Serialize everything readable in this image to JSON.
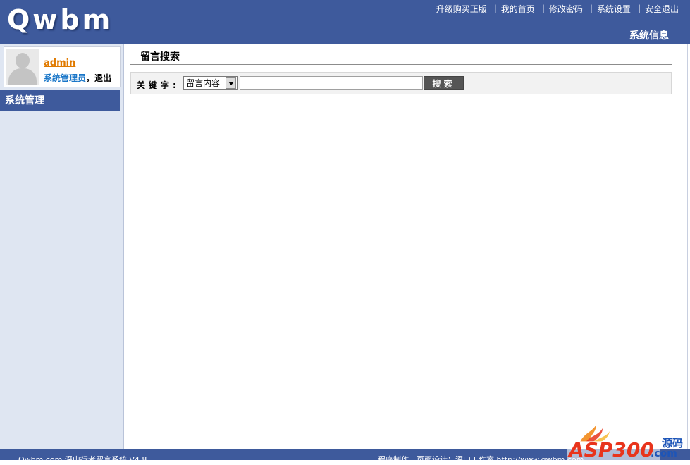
{
  "header": {
    "logo": "Qwbm",
    "nav": [
      {
        "label": "升级购买正版"
      },
      {
        "label": "我的首页"
      },
      {
        "label": "修改密码"
      },
      {
        "label": "系统设置"
      },
      {
        "label": "安全退出"
      }
    ],
    "nav_separator": "|",
    "section_title": "系统信息"
  },
  "sidebar": {
    "user": {
      "name": "admin",
      "role": "系统管理员",
      "comma": "，",
      "logout": "退出"
    },
    "menu_title": "系统管理"
  },
  "main": {
    "page_title": "留言搜索",
    "search": {
      "keyword_label": "关键字:",
      "field_selected": "留言内容",
      "keyword_value": "",
      "button_label": "搜索"
    }
  },
  "footer": {
    "left_text": "Qwbm.com 深山行者留言系统 V4.8",
    "right_text": "程序制作、页面设计：深山工作室 http://www.qwbm.com"
  },
  "watermark": {
    "brand": "ASP300",
    "suffix": ".com",
    "tag": "源码"
  },
  "colors": {
    "brand_blue": "#3e5a9c",
    "sidebar_bg": "#dfe6f2",
    "username": "#e07a00",
    "role": "#1976c8"
  }
}
